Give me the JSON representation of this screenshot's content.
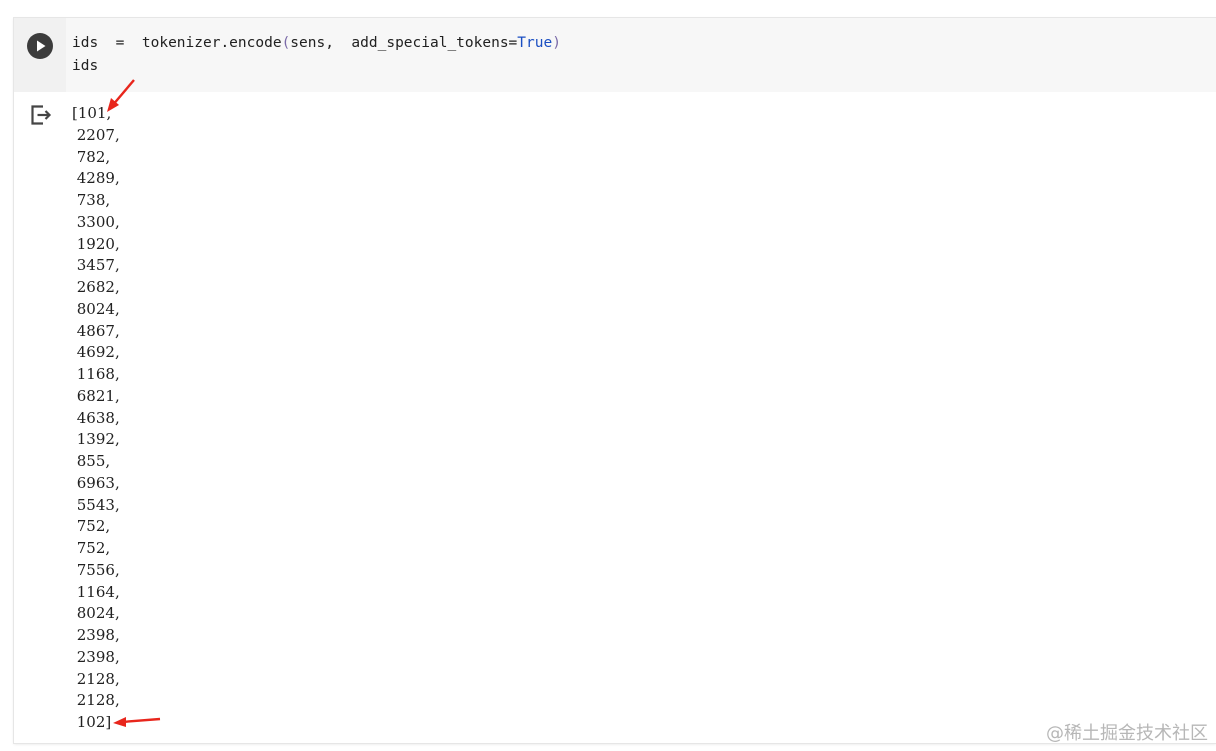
{
  "code_cell": {
    "line1": {
      "var": "ids",
      "op": "=",
      "call": "tokenizer.encode",
      "open_paren": "(",
      "arg1": "sens,",
      "kwarg": "add_special_tokens=",
      "kw_value": "True",
      "close_paren": ")"
    },
    "line2": "ids"
  },
  "output": {
    "lines": [
      "[101,",
      " 2207,",
      " 782,",
      " 4289,",
      " 738,",
      " 3300,",
      " 1920,",
      " 3457,",
      " 2682,",
      " 8024,",
      " 4867,",
      " 4692,",
      " 1168,",
      " 6821,",
      " 4638,",
      " 1392,",
      " 855,",
      " 6963,",
      " 5543,",
      " 752,",
      " 752,",
      " 7556,",
      " 1164,",
      " 8024,",
      " 2398,",
      " 2398,",
      " 2128,",
      " 2128,",
      " 102]"
    ]
  },
  "annotations": {
    "arrow_color": "#e8261c"
  },
  "watermark": "@稀土掘金技术社区",
  "icons": {
    "run": "play-icon",
    "output": "output-exit-icon"
  }
}
